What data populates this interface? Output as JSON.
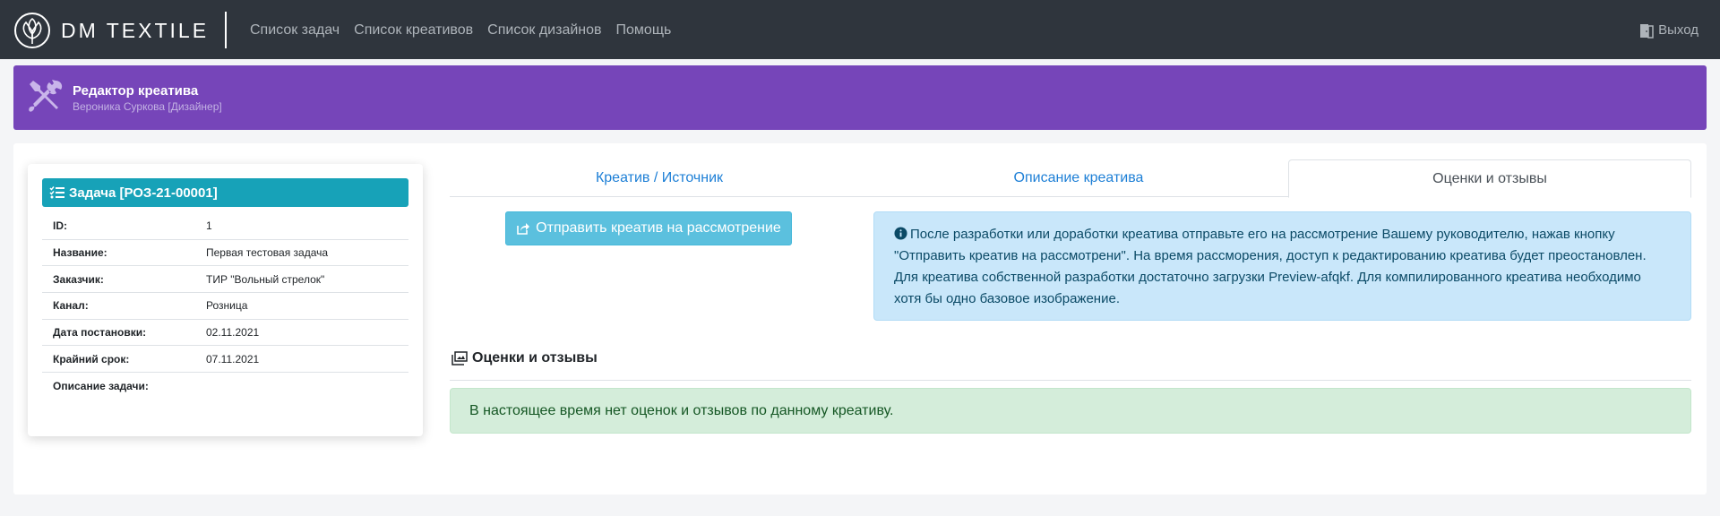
{
  "navbar": {
    "brand": "DM TEXTILE",
    "links": [
      "Список задач",
      "Список креативов",
      "Список дизайнов",
      "Помощь"
    ],
    "exit_label": "Выход"
  },
  "banner": {
    "title": "Редактор креатива",
    "subtitle": "Вероника Суркова [Дизайнер]"
  },
  "task": {
    "header": "Задача [РОЗ-21-00001]",
    "rows": [
      {
        "label": "ID:",
        "value": "1"
      },
      {
        "label": "Название:",
        "value": "Первая тестовая задача"
      },
      {
        "label": "Заказчик:",
        "value": "ТИР \"Вольный стрелок\""
      },
      {
        "label": "Канал:",
        "value": "Розница"
      },
      {
        "label": "Дата постановки:",
        "value": "02.11.2021"
      },
      {
        "label": "Крайний срок:",
        "value": "07.11.2021"
      },
      {
        "label": "Описание задачи:",
        "value": ""
      }
    ]
  },
  "tabs": [
    {
      "label": "Креатив / Источник",
      "active": false
    },
    {
      "label": "Описание креатива",
      "active": false
    },
    {
      "label": "Оценки и отзывы",
      "active": true
    }
  ],
  "send_button": "Отправить креатив на рассмотрение",
  "info_alert": "После разработки или доработки креатива отправьте его на рассмотрение Вашему руководителю, нажав кнопку \"Отправить креатив на рассмотрени\". На время рассморения, доступ к редактированию креатива будет преостановлен. Для креатива собственной разработки достаточно загрузки Preview-afqkf. Для компилированного креатива необходимо хотя бы одно базовое изображение.",
  "reviews": {
    "title": "Оценки и отзывы",
    "empty_message": "В настоящее время нет оценок и отзывов по данному креативу."
  },
  "colors": {
    "navbar": "#2f353d",
    "banner": "#7645b9",
    "task_header": "#17a2b8",
    "send_button": "#5bc0de",
    "info_alert": "#c9e7fa",
    "success_alert": "#d4edda",
    "tab_link": "#1d7fd6"
  },
  "icons": {
    "logo": "cotton-flower-icon",
    "exit": "door-exit-icon",
    "banner": "tools-icon",
    "task": "tasks-list-icon",
    "send": "share-square-icon",
    "info": "info-circle-icon",
    "reviews": "images-icon"
  }
}
